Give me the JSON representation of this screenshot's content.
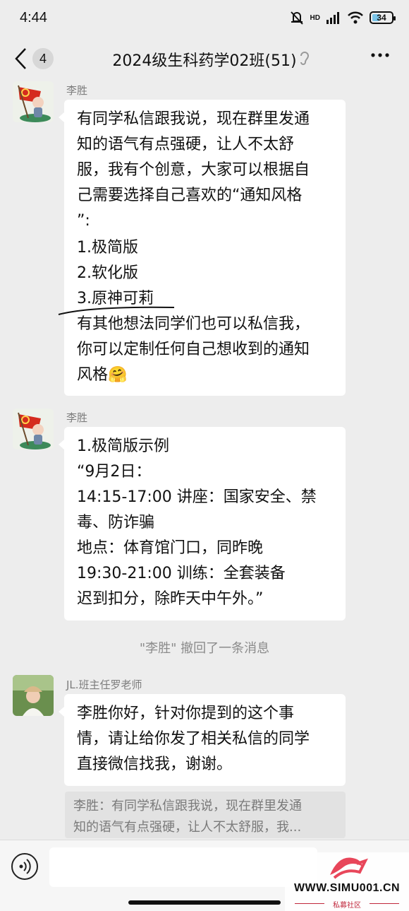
{
  "status_bar": {
    "time": "4:44",
    "network": "HD",
    "battery": "34",
    "battery_level": 0.34
  },
  "header": {
    "unread_count": "4",
    "title": "2024级生科药学02班(51)"
  },
  "messages": [
    {
      "sender": "李胜",
      "lines": [
        "有同学私信跟我说，现在群里发通",
        "知的语气有点强硬，让人不太舒",
        "服，我有个创意，大家可以根据自",
        "己需要选择自己喜欢的“通知风格",
        "”:",
        "1.极简版",
        "2.软化版",
        "3.原神可莉",
        "有其他想法同学们也可以私信我，",
        "你可以定制任何自己想收到的通知",
        "风格"
      ],
      "emoji": "🤗"
    },
    {
      "sender": "李胜",
      "lines": [
        "1.极简版示例",
        "“9月2日：",
        "14:15-17:00 讲座：国家安全、禁",
        "毒、防诈骗",
        "地点：体育馆门口，同昨晚",
        "19:30-21:00 训练：全套装备",
        "迟到扣分，除昨天中午外。”"
      ]
    },
    {
      "sender": "JL.班主任罗老师",
      "lines": [
        "李胜你好，针对你提到的这个事",
        "情，请让给你发了相关私信的同学",
        "直接微信找我，谢谢。"
      ],
      "quote": [
        "李胜：有同学私信跟我说，现在群里发通",
        "知的语气有点强硬，让人不太舒服，我..."
      ]
    }
  ],
  "recall_notice": "\"李胜\" 撤回了一条消息",
  "input": {
    "placeholder": ""
  },
  "watermark": {
    "url": "WWW.SIMU001.CN",
    "sub": "私募社区"
  }
}
